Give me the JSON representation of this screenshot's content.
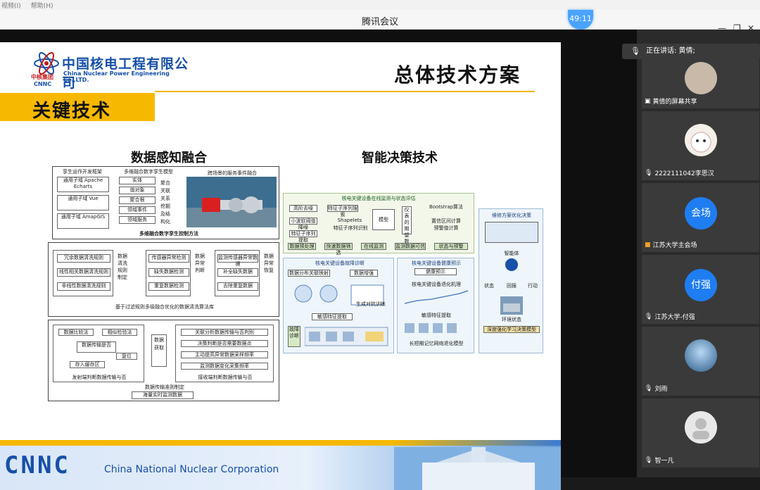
{
  "menubar": [
    "视频(I)",
    "帮助(H)"
  ],
  "window": {
    "title": "腾讯会议",
    "timer": "49:11"
  },
  "slide": {
    "company_cn": "中国核电工程有限公司",
    "company_en": "China Nuclear Power Engineering Co.,LTD.",
    "group_cn": "中核集团",
    "group_abbr": "CNNC",
    "title": "总体技术方案",
    "section": "关键技术",
    "left_heading": "数据感知融合",
    "right_heading": "智能决策技术",
    "left_diagram": {
      "col1_title": "孪生运作开发框架",
      "col1_items": [
        "通用子域 Apache Echarts",
        "通用子域 Vue",
        "通用子域 AmapGIS"
      ],
      "col2_title": "多维融合数字孪生模型",
      "col2_items": [
        "实体",
        "值对象",
        "聚合根",
        "领域事件",
        "领域服务"
      ],
      "col2_side": "聚合关联关系挖掘及结构化",
      "col3_title": "跨场景的服务事件融合",
      "row1_caption": "多维融合数字孪生控制方法",
      "clean_items": [
        "冗余数据清洗规则",
        "线性相关数据清洗规则",
        "非线性数据清洗规则"
      ],
      "clean_side": "数据清洗规则制定",
      "detect_items": [
        "传感器异常检测",
        "缺失数据检测",
        "重复数据检测"
      ],
      "detect_side": "数据异常判断",
      "recover_items": [
        "监测传感器异常数据",
        "补全缺失数据",
        "去除重复数据"
      ],
      "recover_side": "数据异常恢复",
      "row2_caption": "基于过滤规则多级融合优化的数据清洗算法库",
      "flow_items": [
        "数据比较法",
        "相似检验法",
        "数据传输是否",
        "存入缓存区",
        "复位"
      ],
      "flow_caption": "发射端判断数据传输与否",
      "mid_box": "数据获取",
      "rule_items": [
        "关联分析数据传输与否判别",
        "决策判断是否需要数据点",
        "主动提高异常数据采样频率",
        "监测数据变化采集频率"
      ],
      "rule_caption": "接收端判断数据传输与否",
      "row3_caption": "数据传输准则制定",
      "row3_bottom": "海量实时监测数据"
    },
    "right_diagram": {
      "step1_title": "核电关键设备在线监测与状态评估",
      "step1_items": [
        "高阶去噪",
        "小波软阈值降噪",
        "特征子序列提取",
        "特征子序列搜索",
        "Shapelets",
        "特征子序列识别",
        "模型",
        "仪表的期望数据",
        "Bootstrap算法",
        "置信区间计算",
        "预警值计算"
      ],
      "step1_bottom": [
        "数据预处理",
        "快速数据筛选",
        "在线监测",
        "监测数据可信",
        "状态与预警"
      ],
      "step2_title": "核电关键设备故障诊断",
      "step2_items": [
        "数据分布关联映射",
        "数据增强",
        "敏感特征提取",
        "生成对抗训练",
        "故障诊断"
      ],
      "step3_title": "核电关键设备健康预示",
      "step3_items": [
        "健康预示",
        "核电关键设备退化机理",
        "敏感特征提取",
        "长短期记忆网络退化模型"
      ],
      "step4_title": "维修方案优化决策",
      "step4_items": [
        "智能体",
        "状态",
        "回报",
        "行动",
        "环境状态",
        "深度强化学习决策模型"
      ]
    },
    "footer_cnnc": "CNNC",
    "footer_en": "China National Nuclear Corporation"
  },
  "sidebar": {
    "speaking_label": "正在讲话: 黄倩;",
    "participants": [
      {
        "name": "黄倩的屏幕共享",
        "avatar": ""
      },
      {
        "name": "2222111042李思汉",
        "avatar": ""
      },
      {
        "name": "江苏大学主会场",
        "avatar": "会场"
      },
      {
        "name": "江苏大学-付强",
        "avatar": "付强"
      },
      {
        "name": "刘雨",
        "avatar": ""
      },
      {
        "name": "智一凡",
        "avatar": ""
      }
    ]
  },
  "colors": {
    "brand_blue": "#1750a8",
    "accent_yellow": "#f6b800",
    "meeting_blue": "#1f7df2"
  }
}
